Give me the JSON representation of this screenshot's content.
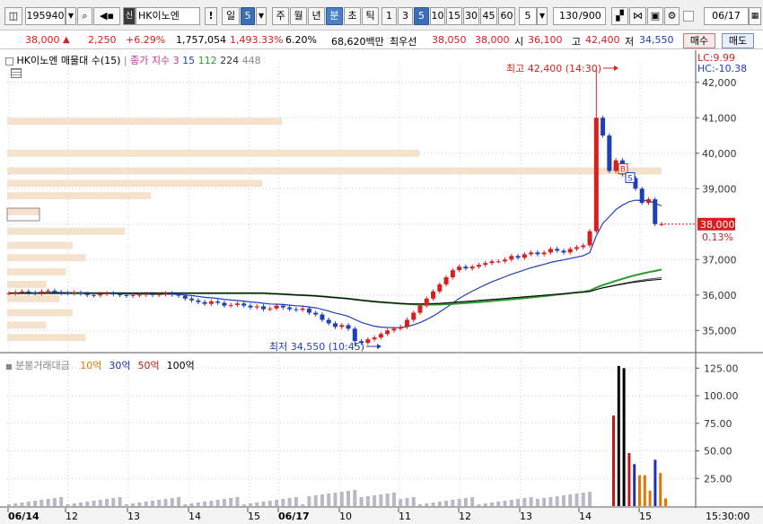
{
  "toolbar": {
    "stock_code": "195940",
    "stock_name": "HK이노엔",
    "exclaim": "!",
    "period_day": "일",
    "period_num": "5",
    "period_week": "주",
    "period_month": "월",
    "period_year": "년",
    "period_minute": "분",
    "period_second": "초",
    "period_tick": "틱",
    "intervals": [
      "1",
      "3",
      "5",
      "10",
      "15",
      "30",
      "45",
      "60"
    ],
    "selected_interval": "5",
    "interval_select": "5",
    "count_value": "130",
    "count_total": "/900",
    "date_value": "06/17"
  },
  "infobar": {
    "price": "38,000",
    "change_arrow": "▲",
    "change": "2,250",
    "change_pct": "+6.29%",
    "volume": "1,757,054",
    "volume_pct": "1,493.33%",
    "turnover": "6.20%",
    "amount": "68,620백만",
    "priority_label": "최우선",
    "ask": "38,050",
    "bid": "38,000",
    "open_label": "시",
    "open": "36,100",
    "high_label": "고",
    "high": "42,400",
    "low_label": "저",
    "low": "34,550",
    "buy_button": "매수",
    "sell_button": "매도"
  },
  "price_panel": {
    "legend_title": "HK이노엔 매물대 수(15)",
    "legend_ma_label": "종가 지수 3",
    "ma_periods": [
      "15",
      "112",
      "224",
      "448"
    ],
    "lc_label": "LC:9.99",
    "hc_label": "HC:-10.38",
    "high_annotation": "최고 42,400 (14:30)",
    "low_annotation": "최저 34,550 (10:45)",
    "current_price_label": "38,000",
    "current_pct_label": "0.13%",
    "y_ticks": [
      "42,000",
      "41,000",
      "40,000",
      "39,000",
      "38,000",
      "37,000",
      "36,000",
      "35,000"
    ],
    "marker_b": "B",
    "marker_s": "S"
  },
  "volume_panel": {
    "legend_title": "분봉거래대금",
    "legend_items": [
      {
        "label": "10억",
        "color": "#e07800"
      },
      {
        "label": "30억",
        "color": "#2030b0"
      },
      {
        "label": "50억",
        "color": "#c01818"
      },
      {
        "label": "100억",
        "color": "#000000"
      }
    ],
    "y_ticks": [
      "125.00",
      "100.00",
      "75.00",
      "50.00",
      "25.00"
    ]
  },
  "time_axis": {
    "labels": [
      "06/14",
      "12",
      "13",
      "14",
      "15",
      "06/17",
      "10",
      "11",
      "12",
      "13",
      "14",
      "15"
    ],
    "end_label": "15:30:00"
  },
  "colors": {
    "up": "#d81f1f",
    "down": "#1f3fb8",
    "ma15": "#1f3fb8",
    "ma112": "#2a9a2a",
    "ma224": "#5a5a5a",
    "ma448": "#000000",
    "volume_profile": "#f5e2cc"
  },
  "chart_data": {
    "type": "candlestick",
    "ylim": [
      34400,
      42500
    ],
    "volume_profile": [
      {
        "price_low": 40800,
        "price_high": 41000,
        "relative": 0.42
      },
      {
        "price_low": 39900,
        "price_high": 40100,
        "relative": 0.63
      },
      {
        "price_low": 39400,
        "price_high": 39600,
        "relative": 1.0
      },
      {
        "price_low": 39050,
        "price_high": 39250,
        "relative": 0.39
      },
      {
        "price_low": 38700,
        "price_high": 38900,
        "relative": 0.22
      },
      {
        "price_low": 38250,
        "price_high": 38450,
        "relative": 0.05
      },
      {
        "price_low": 37700,
        "price_high": 37900,
        "relative": 0.18
      },
      {
        "price_low": 37300,
        "price_high": 37500,
        "relative": 0.1
      },
      {
        "price_low": 36950,
        "price_high": 37150,
        "relative": 0.12
      },
      {
        "price_low": 36550,
        "price_high": 36750,
        "relative": 0.09
      },
      {
        "price_low": 36200,
        "price_high": 36400,
        "relative": 0.06
      },
      {
        "price_low": 35800,
        "price_high": 36000,
        "relative": 0.08
      },
      {
        "price_low": 35400,
        "price_high": 35600,
        "relative": 0.1
      },
      {
        "price_low": 35050,
        "price_high": 35250,
        "relative": 0.06
      },
      {
        "price_low": 34700,
        "price_high": 34900,
        "relative": 0.12
      }
    ],
    "candles_close": [
      36050,
      36080,
      36100,
      36070,
      36050,
      36100,
      36120,
      36080,
      36060,
      36050,
      36070,
      36040,
      36000,
      35990,
      36030,
      36050,
      36020,
      36000,
      35980,
      36000,
      36010,
      36030,
      36000,
      36020,
      36050,
      36010,
      35980,
      35900,
      35850,
      35800,
      35750,
      35820,
      35780,
      35700,
      35720,
      35760,
      35700,
      35650,
      35680,
      35600,
      35620,
      35700,
      35650,
      35600,
      35580,
      35620,
      35500,
      35450,
      35300,
      35200,
      35100,
      35150,
      35050,
      34700,
      34650,
      34750,
      34800,
      34900,
      35000,
      35050,
      35100,
      35300,
      35500,
      35700,
      35900,
      36100,
      36300,
      36500,
      36700,
      36800,
      36750,
      36800,
      36850,
      36900,
      36950,
      36950,
      37000,
      37100,
      37050,
      37150,
      37200,
      37150,
      37200,
      37300,
      37250,
      37200,
      37300,
      37350,
      37400,
      37800,
      41000,
      40500,
      39500,
      39800,
      39400,
      39300,
      39000,
      38600,
      38700,
      38000,
      38000
    ],
    "volume_bars": [
      {
        "slot": 0,
        "value": 82,
        "color": "#c01818"
      },
      {
        "slot": 1,
        "value": 127,
        "color": "#000000"
      },
      {
        "slot": 2,
        "value": 125,
        "color": "#000000"
      },
      {
        "slot": 3,
        "value": 48,
        "color": "#c01818"
      },
      {
        "slot": 4,
        "value": 38,
        "color": "#2030b0"
      },
      {
        "slot": 5,
        "value": 28,
        "color": "#e07800"
      },
      {
        "slot": 6,
        "value": 28,
        "color": "#e07800"
      },
      {
        "slot": 7,
        "value": 14,
        "color": "#e07800"
      },
      {
        "slot": 8,
        "value": 42,
        "color": "#2030b0"
      },
      {
        "slot": 9,
        "value": 30,
        "color": "#e07800"
      },
      {
        "slot": 10,
        "value": 7,
        "color": "#e07800"
      }
    ],
    "vol_ylim": [
      0,
      135
    ]
  }
}
